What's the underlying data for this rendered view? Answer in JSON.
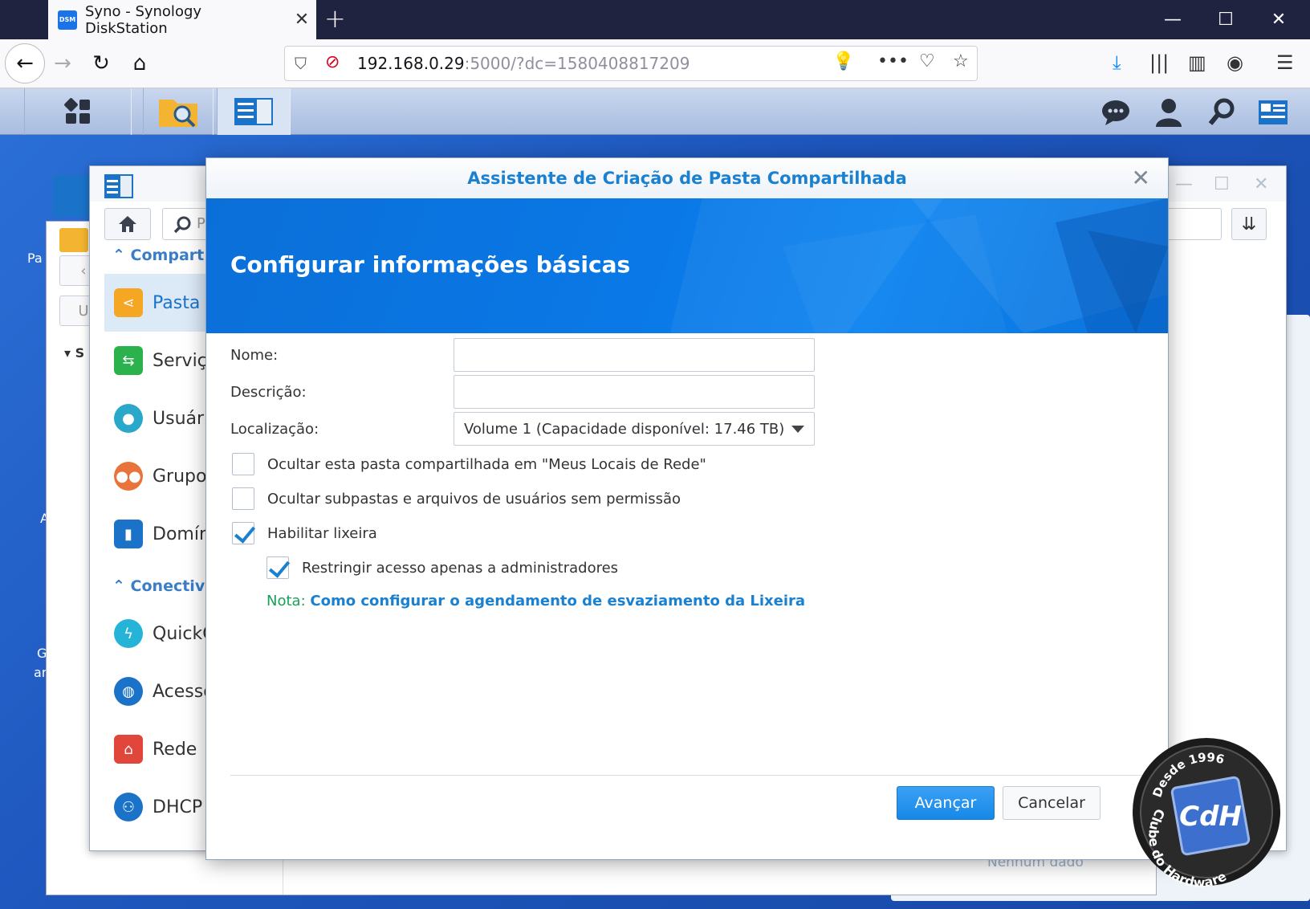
{
  "browser": {
    "tab_title": "Syno - Synology DiskStation",
    "favicon_text": "DSM",
    "url_host": "192.168.0.29",
    "url_rest": ":5000/?dc=1580408817209"
  },
  "control_panel": {
    "sections": [
      {
        "label": "Compart"
      },
      {
        "label": "Conectiv"
      }
    ],
    "items": [
      {
        "label": "Pasta c",
        "icon": "shared-folder-icon",
        "color": "#f5a623"
      },
      {
        "label": "Serviço",
        "icon": "file-services-icon",
        "color": "#2bb24c"
      },
      {
        "label": "Usuário",
        "icon": "user-icon",
        "color": "#2aa8c9"
      },
      {
        "label": "Grupo",
        "icon": "group-icon",
        "color": "#e8743b"
      },
      {
        "label": "Domín",
        "icon": "domain-icon",
        "color": "#1a73c8"
      },
      {
        "label": "QuickC",
        "icon": "quickconnect-icon",
        "color": "#25b4d8"
      },
      {
        "label": "Acesso",
        "icon": "external-access-icon",
        "color": "#1a73c8"
      },
      {
        "label": "Rede",
        "icon": "network-icon",
        "color": "#e0463a"
      },
      {
        "label": "DHCP S",
        "icon": "dhcp-icon",
        "color": "#1a73c8"
      }
    ],
    "search_placeholder": "P"
  },
  "desktop": {
    "labels": [
      "Pa",
      "A",
      "G",
      "ar"
    ],
    "bg_row_text": "U",
    "bg_section": "S",
    "empty_text": "Nenhum dado"
  },
  "wizard": {
    "title": "Assistente de Criação de Pasta Compartilhada",
    "heading": "Configurar informações básicas",
    "fields": {
      "name_label": "Nome:",
      "name_value": "",
      "description_label": "Descrição:",
      "description_value": "",
      "location_label": "Localização:",
      "location_value": "Volume 1 (Capacidade disponível: 17.46 TB)"
    },
    "checkboxes": [
      {
        "label": "Ocultar esta pasta compartilhada em \"Meus Locais de Rede\"",
        "checked": false
      },
      {
        "label": "Ocultar subpastas e arquivos de usuários sem permissão",
        "checked": false
      },
      {
        "label": "Habilitar lixeira",
        "checked": true
      },
      {
        "label": "Restringir acesso apenas a administradores",
        "checked": true
      }
    ],
    "note_label": "Nota:",
    "note_link": "Como configurar o agendamento de esvaziamento da Lixeira",
    "next_button": "Avançar",
    "cancel_button": "Cancelar"
  },
  "watermark": {
    "top_text": "Desde 1996",
    "side_text": "Clube do Hardware",
    "logo_text": "CdH"
  }
}
